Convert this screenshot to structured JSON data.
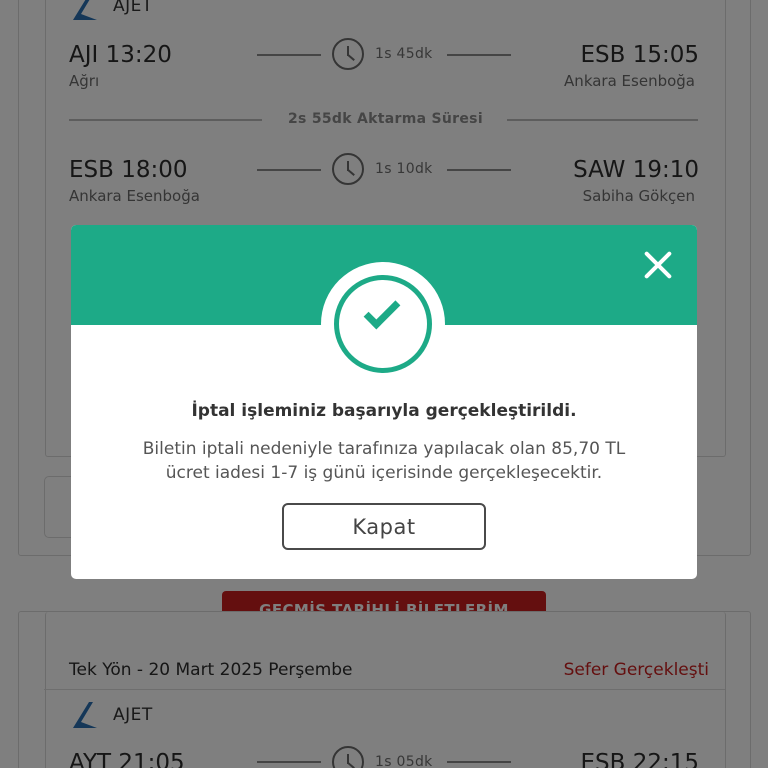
{
  "top_card": {
    "airline": "AJET",
    "leg1": {
      "dep_code_time": "AJI 13:20",
      "dep_city": "Ağrı",
      "duration": "1s 45dk",
      "arr_code_time": "ESB 15:05",
      "arr_city": "Ankara Esenboğa"
    },
    "layover": "2s 55dk Aktarma Süresi",
    "leg2": {
      "dep_code_time": "ESB 18:00",
      "dep_city": "Ankara Esenboğa",
      "duration": "1s 10dk",
      "arr_code_time": "SAW 19:10",
      "arr_city": "Sabiha Gökçen"
    }
  },
  "past_tickets_label": "GEÇMİŞ TARİHLİ BİLETLERİM",
  "past_card": {
    "trip_label": "Tek Yön - 20 Mart 2025 Perşembe",
    "status": "Sefer Gerçekleşti",
    "airline": "AJET",
    "leg1": {
      "dep_code_time": "AYT 21:05",
      "duration": "1s 05dk",
      "arr_code_time": "ESB 22:15"
    }
  },
  "modal": {
    "title": "İptal işleminiz başarıyla gerçekleştirildi.",
    "message_line1": "Biletin iptali nedeniyle tarafınıza yapılacak olan 85,70 TL",
    "message_line2": "ücret iadesi 1-7 iş günü içerisinde gerçekleşecektir.",
    "button_label": "Kapat"
  },
  "colors": {
    "accent_green": "#1daa87",
    "status_red": "#c81e1e",
    "brand_blue": "#2a6fb0"
  },
  "icons": [
    "ajet-logo-icon",
    "clock-icon",
    "close-icon",
    "check-circle-icon"
  ]
}
